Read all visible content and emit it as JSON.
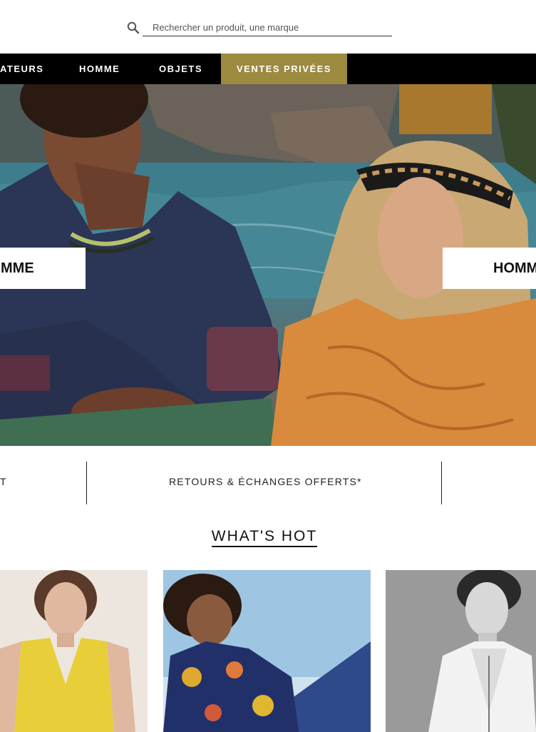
{
  "search": {
    "placeholder": "Rechercher un produit, une marque",
    "icon": "search-icon"
  },
  "nav": {
    "items": [
      {
        "label": "ATEURS"
      },
      {
        "label": "HOMME"
      },
      {
        "label": "OBJETS"
      },
      {
        "label": "VENTES PRIVÉES",
        "highlighted": true
      }
    ],
    "highlight_color": "#9c8a3f"
  },
  "hero": {
    "left_label": "MME",
    "right_label": "HOMM"
  },
  "info_strip": {
    "left_text": "T",
    "center_text": "RETOURS & ÉCHANGES OFFERTS*"
  },
  "whats_hot": {
    "title": "WHAT'S HOT"
  },
  "colors": {
    "nav_bg": "#000000",
    "accent_gold": "#9c8a3f"
  }
}
